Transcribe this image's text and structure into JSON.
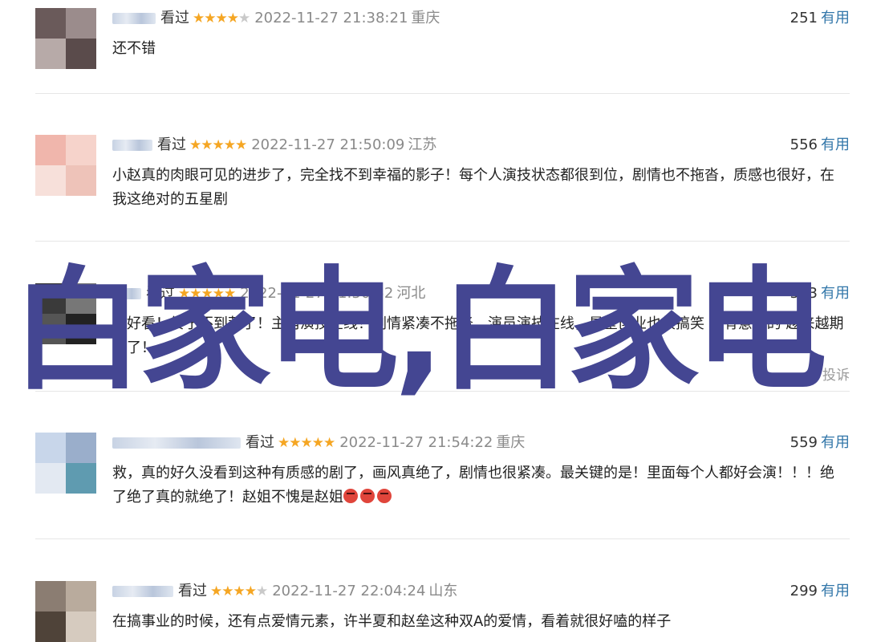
{
  "overlay_text": "白家电,白家电",
  "reviews": [
    {
      "status": "看过",
      "stars": 4,
      "time": "2022-11-27 21:38:21",
      "location": "重庆",
      "votes": "251",
      "useful_label": "有用",
      "content": "还不错"
    },
    {
      "status": "看过",
      "stars": 5,
      "time": "2022-11-27 21:50:09",
      "location": "江苏",
      "votes": "556",
      "useful_label": "有用",
      "content": "小赵真的肉眼可见的进步了，完全找不到幸福的影子！每个人演技状态都很到位，剧情也不拖沓，质感也很好，在我这绝对的五星剧"
    },
    {
      "status": "看过",
      "stars": 5,
      "time": "2022-11-27 21:50:52",
      "location": "河北",
      "votes": "543",
      "useful_label": "有用",
      "content": "很好看！终于不到荒了！主角演技在线！剧情紧凑不拖沓，演员演技在线，是星创业也很搞笑 挺有意思的 越来越期待了！",
      "report_label": "投诉"
    },
    {
      "status": "看过",
      "stars": 5,
      "time": "2022-11-27 21:54:22",
      "location": "重庆",
      "votes": "559",
      "useful_label": "有用",
      "content": "救，真的好久没看到这种有质感的剧了，画风真绝了，剧情也很紧凑。最关键的是！里面每个人都好会演！！！绝了绝了真的就绝了！赵姐不愧是赵姐"
    },
    {
      "status": "看过",
      "stars": 4,
      "time": "2022-11-27 22:04:24",
      "location": "山东",
      "votes": "299",
      "useful_label": "有用",
      "content": "在搞事业的时候，还有点爱情元素，许半夏和赵垒这种双A的爱情，看着就很好嗑的样子"
    }
  ],
  "colors": {
    "accent": "#3377aa",
    "star": "#f5a623",
    "overlay": "#444692"
  }
}
